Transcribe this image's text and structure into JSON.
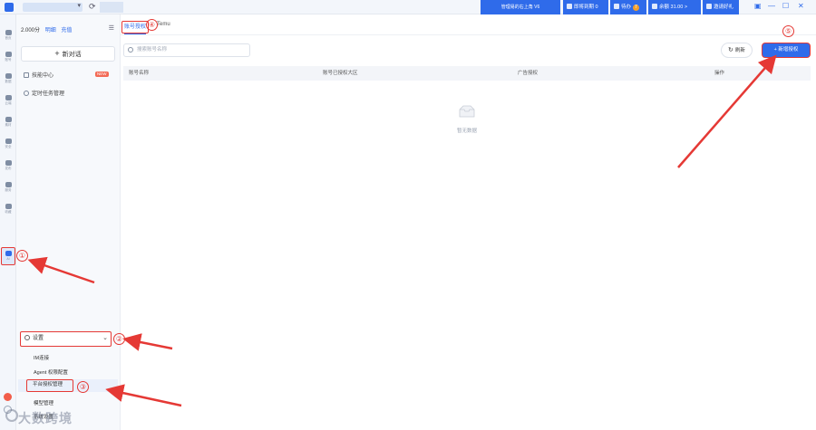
{
  "topbar": {
    "center_title": "管理易的右上角 V6",
    "items": [
      {
        "label": "即将到期 0",
        "icon": "bell-icon"
      },
      {
        "label": "待办",
        "badge": "7",
        "icon": "todo-icon"
      },
      {
        "label": "余额 31.00 >",
        "icon": "wallet-icon"
      },
      {
        "label": "邀请好礼",
        "icon": "gift-icon"
      }
    ]
  },
  "rail": {
    "items": [
      "首页",
      "账号",
      "数据",
      "云端",
      "素材",
      "安全",
      "发布",
      "服务",
      "收藏",
      "AI"
    ]
  },
  "panel": {
    "credits": "2.000分",
    "credits_link1": "明细",
    "credits_link2": "充值",
    "new_chat": "新对话",
    "items": [
      {
        "label": "技能中心",
        "badge": "NEW"
      },
      {
        "label": "定时任务管理"
      }
    ],
    "settings": "设置",
    "sub_items": [
      "IM连接",
      "Agent 权限配置",
      "平台授权管理",
      "模型管理",
      "系统设置"
    ]
  },
  "main": {
    "tabs": [
      "账号授权",
      "Temu"
    ],
    "search_placeholder": "搜索账号名称",
    "refresh": "刷新",
    "add": "新增授权",
    "columns": [
      "账号名称",
      "账号已授权大区",
      "广告授权",
      "操作"
    ],
    "empty": "暂无数据"
  },
  "annotations": [
    "①",
    "②",
    "③",
    "④",
    "⑤"
  ],
  "watermark": "大数跨境",
  "colors": {
    "accent": "#2f6bea",
    "annotation": "#e53935"
  }
}
